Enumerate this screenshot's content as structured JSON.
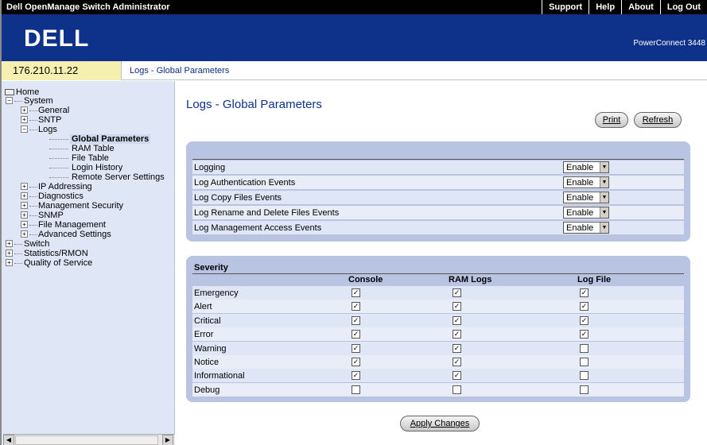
{
  "topbar": {
    "title": "Dell OpenManage Switch Administrator",
    "links": [
      "Support",
      "Help",
      "About",
      "Log Out"
    ]
  },
  "banner": {
    "logo": "DELL",
    "product": "PowerConnect 3448"
  },
  "breadcrumb": {
    "ip": "176.210.11.22",
    "path": "Logs - Global Parameters"
  },
  "sidebar": {
    "home": "Home",
    "system": "System",
    "general": "General",
    "sntp": "SNTP",
    "logs": "Logs",
    "logs_children": [
      "Global Parameters",
      "RAM Table",
      "File Table",
      "Login History",
      "Remote Server Settings"
    ],
    "system_rest": [
      "IP Addressing",
      "Diagnostics",
      "Management Security",
      "SNMP",
      "File Management",
      "Advanced Settings"
    ],
    "top_rest": [
      "Switch",
      "Statistics/RMON",
      "Quality of Service"
    ]
  },
  "main": {
    "title": "Logs - Global Parameters",
    "print_label": "Print",
    "refresh_label": "Refresh",
    "apply_label": "Apply Changes"
  },
  "global_settings": [
    {
      "label": "Logging",
      "value": "Enable"
    },
    {
      "label": "Log Authentication Events",
      "value": "Enable"
    },
    {
      "label": "Log Copy Files Events",
      "value": "Enable"
    },
    {
      "label": "Log Rename and Delete Files Events",
      "value": "Enable"
    },
    {
      "label": "Log Management Access Events",
      "value": "Enable"
    }
  ],
  "severity": {
    "title": "Severity",
    "columns": [
      "Console",
      "RAM Logs",
      "Log File"
    ],
    "rows": [
      {
        "name": "Emergency",
        "checks": [
          true,
          true,
          true
        ]
      },
      {
        "name": "Alert",
        "checks": [
          true,
          true,
          true
        ]
      },
      {
        "name": "Critical",
        "checks": [
          true,
          true,
          true
        ]
      },
      {
        "name": "Error",
        "checks": [
          true,
          true,
          true
        ]
      },
      {
        "name": "Warning",
        "checks": [
          true,
          true,
          false
        ]
      },
      {
        "name": "Notice",
        "checks": [
          true,
          true,
          false
        ]
      },
      {
        "name": "Informational",
        "checks": [
          true,
          true,
          false
        ]
      },
      {
        "name": "Debug",
        "checks": [
          false,
          false,
          false
        ]
      }
    ]
  },
  "colors": {
    "brand": "#0e3289",
    "panel": "#b9c4e3",
    "sidebar": "#dfe7f6"
  }
}
